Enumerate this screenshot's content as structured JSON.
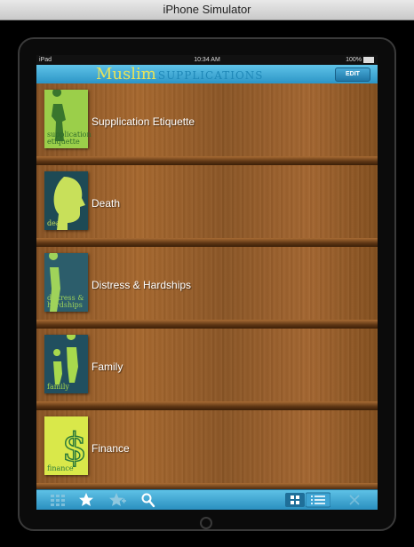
{
  "simulator": {
    "title": "iPhone Simulator"
  },
  "statusbar": {
    "device": "iPad",
    "time": "10:34 AM",
    "battery": "100%"
  },
  "header": {
    "logo_main": "Muslim",
    "logo_sub": "SUPPLICATIONS",
    "edit_label": "EDIT"
  },
  "books": [
    {
      "title": "Supplication Etiquette",
      "cover_text": "supplication etiquette",
      "cover_bg": "#9bcf4a",
      "cover_fg": "#2f6b2a"
    },
    {
      "title": "Death",
      "cover_text": "death",
      "cover_bg": "#1e4a55",
      "cover_fg": "#c8e05a"
    },
    {
      "title": "Distress & Hardships",
      "cover_text": "distress & hardships",
      "cover_bg": "#2c5d6b",
      "cover_fg": "#9fd35a"
    },
    {
      "title": "Family",
      "cover_text": "family",
      "cover_bg": "#214f5f",
      "cover_fg": "#a8d94d"
    },
    {
      "title": "Finance",
      "cover_text": "finance",
      "cover_bg": "#d9e84a",
      "cover_fg": "#2c7a3a"
    }
  ],
  "toolbar": {
    "icons": [
      "grid-menu-icon",
      "star-icon",
      "star-add-icon",
      "search-icon",
      "grid-view-icon",
      "list-view-icon",
      "close-icon"
    ],
    "accent": "#2a8fbf"
  }
}
